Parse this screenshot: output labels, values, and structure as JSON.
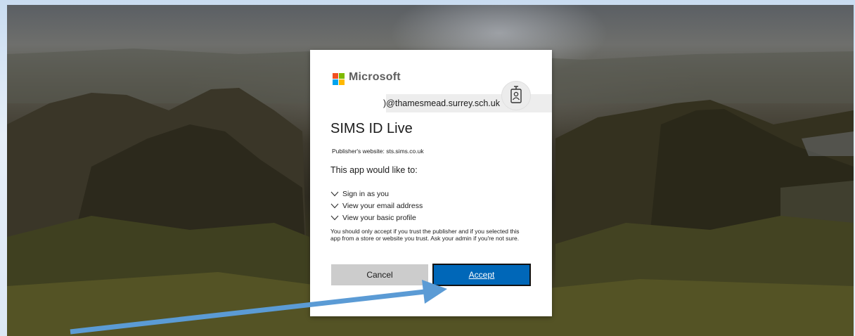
{
  "brand": {
    "name": "Microsoft",
    "logo_colors": [
      "#f25022",
      "#7fba00",
      "#00a4ef",
      "#ffb900"
    ]
  },
  "account": {
    "email": ")@thamesmead.surrey.sch.uk",
    "icon": "account-badge-icon"
  },
  "app": {
    "title": "SIMS ID Live",
    "publisher_line": "Publisher's website: sts.sims.co.uk"
  },
  "consent": {
    "heading": "This app would like to:",
    "permissions": [
      {
        "label": "Sign in as you",
        "icon": "chevron-down-icon"
      },
      {
        "label": "View your email address",
        "icon": "chevron-down-icon"
      },
      {
        "label": "View your basic profile",
        "icon": "chevron-down-icon"
      }
    ],
    "notice": "You should only accept if you trust the publisher and if you selected this app from a store or website you trust. Ask your admin if you're not sure."
  },
  "buttons": {
    "cancel_label": "Cancel",
    "accept_label": "Accept"
  },
  "colors": {
    "accent": "#0067b8",
    "annotation_arrow": "#5b9bd5",
    "cancel_bg": "#cccccc"
  }
}
